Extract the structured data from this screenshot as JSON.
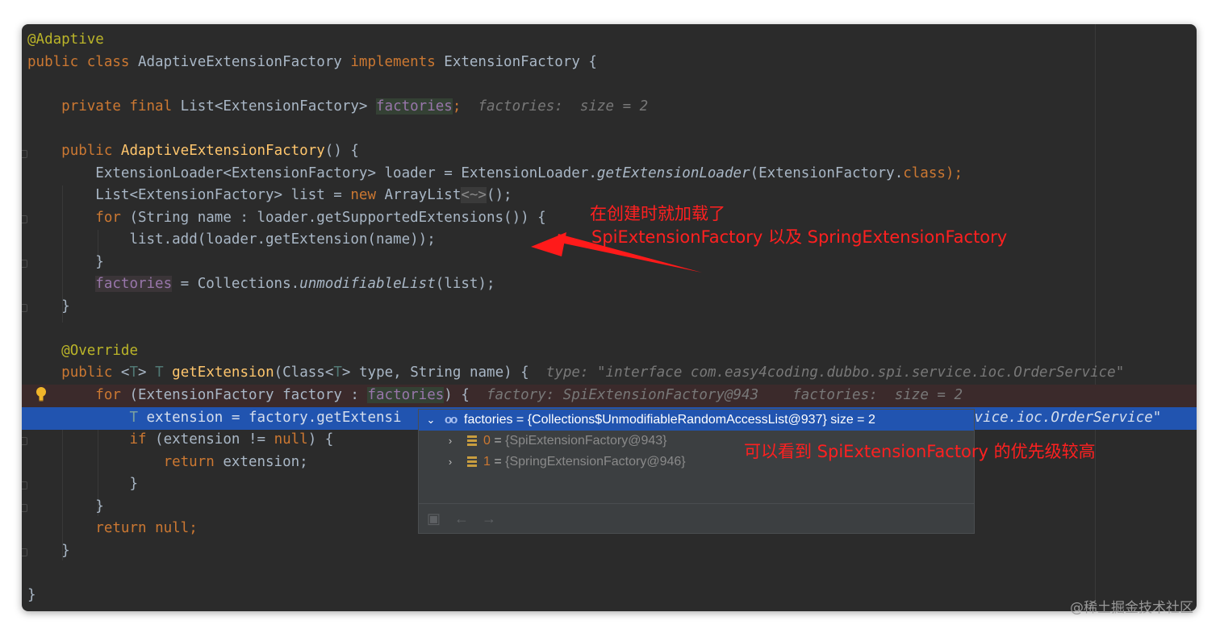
{
  "code": {
    "l1_annotation": "@Adaptive",
    "l2_kw": "public class ",
    "l2_class": "AdaptiveExtensionFactory ",
    "l2_impl": "implements ",
    "l2_iface": "ExtensionFactory {",
    "l4_kw": "private final ",
    "l4_type": "List<ExtensionFactory> ",
    "l4_field": "factories",
    "l4_semi": ";",
    "l4_hint": "factories:  size = 2",
    "l6_kw": "public ",
    "l6_name": "AdaptiveExtensionFactory",
    "l6_rest": "() {",
    "l7_a": "ExtensionLoader<ExtensionFactory> loader = ExtensionLoader.",
    "l7_method": "getExtensionLoader",
    "l7_b": "(ExtensionFactory.",
    "l7_class": "class",
    "l7_c": ");",
    "l8_a": "List<ExtensionFactory> list = ",
    "l8_new": "new ",
    "l8_b": "ArrayList",
    "l8_diamond": "<~>",
    "l8_c": "();",
    "l9_for": "for ",
    "l9_rest": "(String name : loader.getSupportedExtensions()) {",
    "l10": "list.add(loader.getExtension(name));",
    "l11": "}",
    "l12_field": "factories",
    "l12_a": " = Collections.",
    "l12_method": "unmodifiableList",
    "l12_b": "(list);",
    "l13": "}",
    "l15_annotation": "@Override",
    "l16_kw": "public ",
    "l16_lt": "<",
    "l16_t": "T",
    "l16_gt": "> ",
    "l16_t2": "T ",
    "l16_name": "getExtension",
    "l16_a": "(Class<",
    "l16_t3": "T",
    "l16_b": "> type, String name) {",
    "l16_hint": "type: \"interface com.easy4coding.dubbo.spi.service.ioc.OrderService\"",
    "l17_for": "for ",
    "l17_a": "(ExtensionFactory factory : ",
    "l17_field": "factories",
    "l17_b": ") {",
    "l17_hint": "factory: SpiExtensionFactory@943    factories:  size = 2",
    "l18_t": "T ",
    "l18_a": "extension = factory.getExtensi",
    "l18_hint_tail": "rvice.ioc.OrderService\"",
    "l19_if": "if ",
    "l19_a": "(extension != ",
    "l19_null": "null",
    "l19_b": ") {",
    "l20_return": "return ",
    "l20_a": "extension;",
    "l21": "}",
    "l22": "}",
    "l23_return": "return ",
    "l23_null": "null;",
    "l24": "}",
    "l26": "}"
  },
  "debug_popup": {
    "root_label": "factories = {Collections$UnmodifiableRandomAccessList@937}  size = 2",
    "items": [
      {
        "index": "0",
        "eq": " = ",
        "value": "{SpiExtensionFactory@943}"
      },
      {
        "index": "1",
        "eq": " = ",
        "value": "{SpringExtensionFactory@946}"
      }
    ]
  },
  "annotations": {
    "note1_line1": "在创建时就加载了",
    "note1_line2": "SpiExtensionFactory 以及 SpringExtensionFactory",
    "note2": "可以看到 SpiExtensionFactory 的优先级较高"
  },
  "watermark": "@稀土掘金技术社区",
  "colors": {
    "keyword": "#cc7832",
    "annotation": "#bbb529",
    "method": "#ffc66d",
    "field": "#9876aa",
    "selection": "#2154b0",
    "note_red": "#ff2020"
  }
}
